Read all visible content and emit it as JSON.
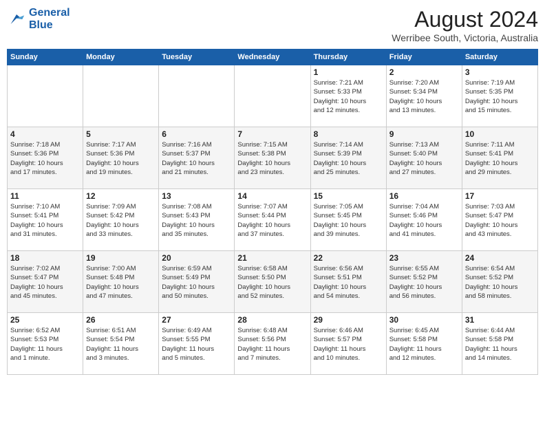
{
  "logo": {
    "line1": "General",
    "line2": "Blue"
  },
  "title": "August 2024",
  "location": "Werribee South, Victoria, Australia",
  "weekdays": [
    "Sunday",
    "Monday",
    "Tuesday",
    "Wednesday",
    "Thursday",
    "Friday",
    "Saturday"
  ],
  "weeks": [
    [
      {
        "day": "",
        "info": ""
      },
      {
        "day": "",
        "info": ""
      },
      {
        "day": "",
        "info": ""
      },
      {
        "day": "",
        "info": ""
      },
      {
        "day": "1",
        "info": "Sunrise: 7:21 AM\nSunset: 5:33 PM\nDaylight: 10 hours\nand 12 minutes."
      },
      {
        "day": "2",
        "info": "Sunrise: 7:20 AM\nSunset: 5:34 PM\nDaylight: 10 hours\nand 13 minutes."
      },
      {
        "day": "3",
        "info": "Sunrise: 7:19 AM\nSunset: 5:35 PM\nDaylight: 10 hours\nand 15 minutes."
      }
    ],
    [
      {
        "day": "4",
        "info": "Sunrise: 7:18 AM\nSunset: 5:36 PM\nDaylight: 10 hours\nand 17 minutes."
      },
      {
        "day": "5",
        "info": "Sunrise: 7:17 AM\nSunset: 5:36 PM\nDaylight: 10 hours\nand 19 minutes."
      },
      {
        "day": "6",
        "info": "Sunrise: 7:16 AM\nSunset: 5:37 PM\nDaylight: 10 hours\nand 21 minutes."
      },
      {
        "day": "7",
        "info": "Sunrise: 7:15 AM\nSunset: 5:38 PM\nDaylight: 10 hours\nand 23 minutes."
      },
      {
        "day": "8",
        "info": "Sunrise: 7:14 AM\nSunset: 5:39 PM\nDaylight: 10 hours\nand 25 minutes."
      },
      {
        "day": "9",
        "info": "Sunrise: 7:13 AM\nSunset: 5:40 PM\nDaylight: 10 hours\nand 27 minutes."
      },
      {
        "day": "10",
        "info": "Sunrise: 7:11 AM\nSunset: 5:41 PM\nDaylight: 10 hours\nand 29 minutes."
      }
    ],
    [
      {
        "day": "11",
        "info": "Sunrise: 7:10 AM\nSunset: 5:41 PM\nDaylight: 10 hours\nand 31 minutes."
      },
      {
        "day": "12",
        "info": "Sunrise: 7:09 AM\nSunset: 5:42 PM\nDaylight: 10 hours\nand 33 minutes."
      },
      {
        "day": "13",
        "info": "Sunrise: 7:08 AM\nSunset: 5:43 PM\nDaylight: 10 hours\nand 35 minutes."
      },
      {
        "day": "14",
        "info": "Sunrise: 7:07 AM\nSunset: 5:44 PM\nDaylight: 10 hours\nand 37 minutes."
      },
      {
        "day": "15",
        "info": "Sunrise: 7:05 AM\nSunset: 5:45 PM\nDaylight: 10 hours\nand 39 minutes."
      },
      {
        "day": "16",
        "info": "Sunrise: 7:04 AM\nSunset: 5:46 PM\nDaylight: 10 hours\nand 41 minutes."
      },
      {
        "day": "17",
        "info": "Sunrise: 7:03 AM\nSunset: 5:47 PM\nDaylight: 10 hours\nand 43 minutes."
      }
    ],
    [
      {
        "day": "18",
        "info": "Sunrise: 7:02 AM\nSunset: 5:47 PM\nDaylight: 10 hours\nand 45 minutes."
      },
      {
        "day": "19",
        "info": "Sunrise: 7:00 AM\nSunset: 5:48 PM\nDaylight: 10 hours\nand 47 minutes."
      },
      {
        "day": "20",
        "info": "Sunrise: 6:59 AM\nSunset: 5:49 PM\nDaylight: 10 hours\nand 50 minutes."
      },
      {
        "day": "21",
        "info": "Sunrise: 6:58 AM\nSunset: 5:50 PM\nDaylight: 10 hours\nand 52 minutes."
      },
      {
        "day": "22",
        "info": "Sunrise: 6:56 AM\nSunset: 5:51 PM\nDaylight: 10 hours\nand 54 minutes."
      },
      {
        "day": "23",
        "info": "Sunrise: 6:55 AM\nSunset: 5:52 PM\nDaylight: 10 hours\nand 56 minutes."
      },
      {
        "day": "24",
        "info": "Sunrise: 6:54 AM\nSunset: 5:52 PM\nDaylight: 10 hours\nand 58 minutes."
      }
    ],
    [
      {
        "day": "25",
        "info": "Sunrise: 6:52 AM\nSunset: 5:53 PM\nDaylight: 11 hours\nand 1 minute."
      },
      {
        "day": "26",
        "info": "Sunrise: 6:51 AM\nSunset: 5:54 PM\nDaylight: 11 hours\nand 3 minutes."
      },
      {
        "day": "27",
        "info": "Sunrise: 6:49 AM\nSunset: 5:55 PM\nDaylight: 11 hours\nand 5 minutes."
      },
      {
        "day": "28",
        "info": "Sunrise: 6:48 AM\nSunset: 5:56 PM\nDaylight: 11 hours\nand 7 minutes."
      },
      {
        "day": "29",
        "info": "Sunrise: 6:46 AM\nSunset: 5:57 PM\nDaylight: 11 hours\nand 10 minutes."
      },
      {
        "day": "30",
        "info": "Sunrise: 6:45 AM\nSunset: 5:58 PM\nDaylight: 11 hours\nand 12 minutes."
      },
      {
        "day": "31",
        "info": "Sunrise: 6:44 AM\nSunset: 5:58 PM\nDaylight: 11 hours\nand 14 minutes."
      }
    ]
  ]
}
